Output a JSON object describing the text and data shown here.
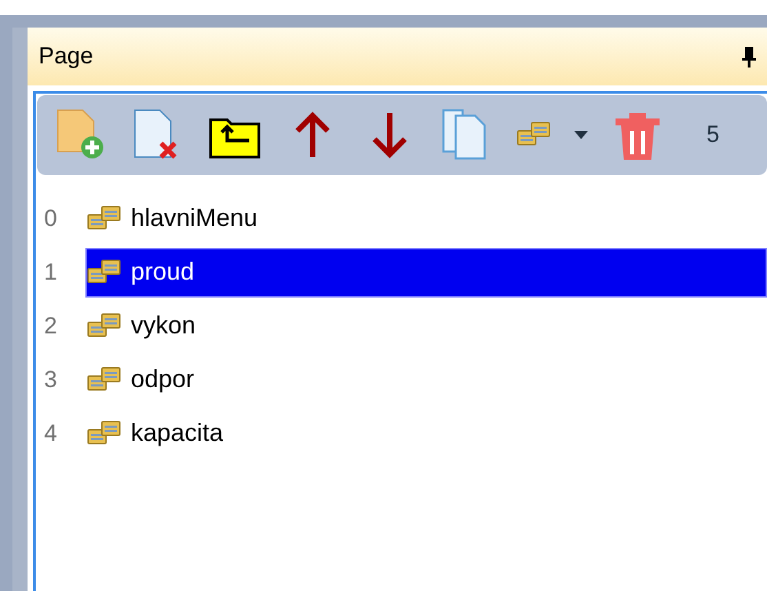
{
  "panel": {
    "title": "Page"
  },
  "toolbar": {
    "buttons": [
      {
        "kind": "add"
      },
      {
        "kind": "remove"
      },
      {
        "kind": "folder-up"
      },
      {
        "kind": "up"
      },
      {
        "kind": "down"
      },
      {
        "kind": "copy"
      },
      {
        "kind": "group"
      },
      {
        "kind": "dropdown"
      },
      {
        "kind": "delete"
      }
    ],
    "count": "5"
  },
  "pages": [
    {
      "index": "0",
      "name": "hlavniMenu",
      "selected": false
    },
    {
      "index": "1",
      "name": "proud",
      "selected": true
    },
    {
      "index": "2",
      "name": "vykon",
      "selected": false
    },
    {
      "index": "3",
      "name": "odpor",
      "selected": false
    },
    {
      "index": "4",
      "name": "kapacita",
      "selected": false
    }
  ]
}
